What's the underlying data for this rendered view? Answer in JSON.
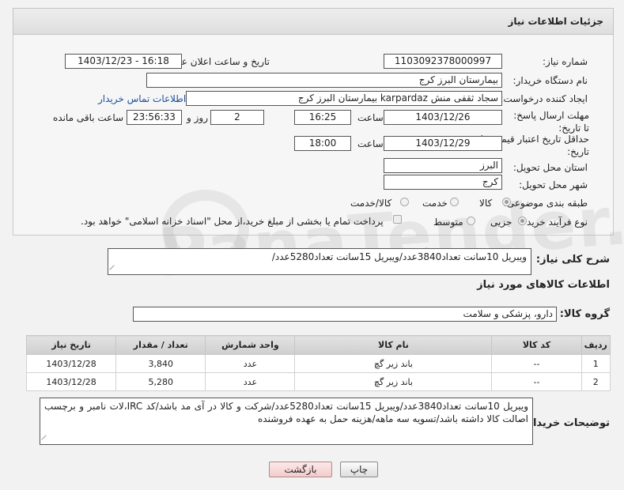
{
  "header": {
    "title": "جزئیات اطلاعات نیاز"
  },
  "fields": {
    "need_number_label": "شماره نیاز:",
    "need_number": "1103092378000997",
    "announce_label": "تاریخ و ساعت اعلان عمومی:",
    "announce_value": "1403/12/23 - 16:18",
    "buyer_label": "نام دستگاه خریدار:",
    "buyer_value": "بیمارستان البرز کرج",
    "creator_label": "ایجاد کننده درخواست:",
    "creator_value": "سجاد ثقفی منش karpardaz بیمارستان البرز کرج",
    "contact_link": "اطلاعات تماس خریدار",
    "deadline_label": "مهلت ارسال پاسخ: تا تاریخ:",
    "deadline_date": "1403/12/26",
    "time_label": "ساعت",
    "deadline_time": "16:25",
    "days_value": "2",
    "days_label": "روز و",
    "remaining_value": "23:56:33",
    "remaining_label": "ساعت باقی مانده",
    "price_validity_label": "حداقل تاریخ اعتبار قیمت: تا تاریخ:",
    "price_validity_date": "1403/12/29",
    "price_validity_time": "18:00",
    "province_label": "استان محل تحویل:",
    "province_value": "البرز",
    "city_label": "شهر محل تحویل:",
    "city_value": "کرج",
    "category_label": "طبقه بندی موضوعی:",
    "category_options": [
      "کالا",
      "خدمت",
      "کالا/خدمت"
    ],
    "process_label": "نوع فرآیند خرید :",
    "process_options": [
      "جزیی",
      "متوسط"
    ],
    "payment_note": "پرداخت تمام یا بخشی از مبلغ خرید،از محل \"اسناد خزانه اسلامی\" خواهد بود."
  },
  "watermark": {
    "text": "PanaTender.net"
  },
  "description": {
    "label": "شرح کلی نیاز:",
    "value": "ویبریل 10سانت تعداد3840عدد/ویبریل 15سانت تعداد5280عدد/"
  },
  "goods": {
    "section_title": "اطلاعات کالاهای مورد نیاز",
    "group_label": "گروه کالا:",
    "group_value": "دارو، پزشکی و سلامت",
    "columns": [
      "ردیف",
      "کد کالا",
      "نام کالا",
      "واحد شمارش",
      "تعداد / مقدار",
      "تاریخ نیاز"
    ],
    "rows": [
      {
        "index": "1",
        "code": "--",
        "name": "باند زیر گچ",
        "unit": "عدد",
        "qty": "3,840",
        "date": "1403/12/28"
      },
      {
        "index": "2",
        "code": "--",
        "name": "باند زیر گچ",
        "unit": "عدد",
        "qty": "5,280",
        "date": "1403/12/28"
      }
    ]
  },
  "buyer_notes": {
    "label": "توضیحات خریدار:",
    "value": "ویبریل 10سانت تعداد3840عدد/ویبریل 15سانت تعداد5280عدد/شرکت و کالا در آی مد باشد/کد IRC،لات نامبر و برچسب اصالت کالا داشته باشد/تسویه سه ماهه/هزینه حمل به عهده فروشنده"
  },
  "buttons": {
    "print": "چاپ",
    "back": "بازگشت"
  }
}
